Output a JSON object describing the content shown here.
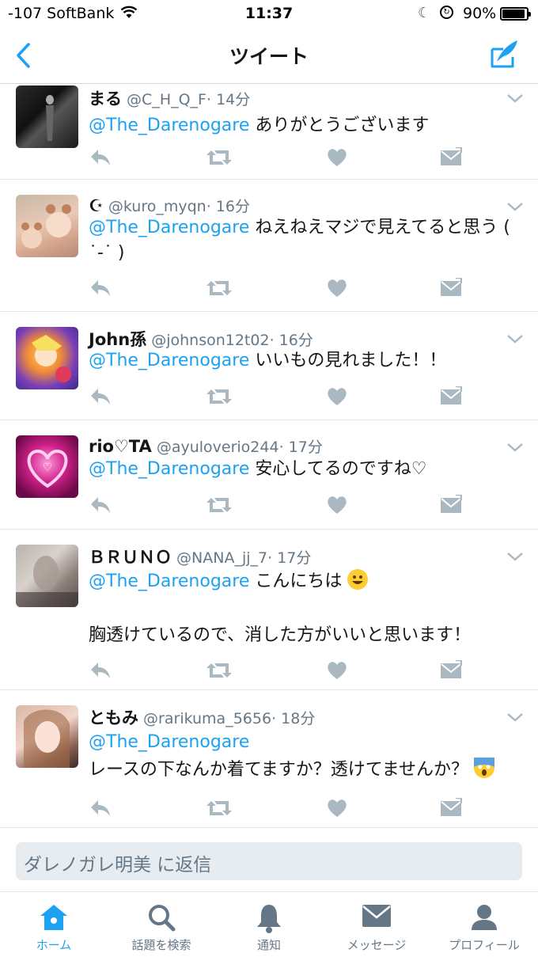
{
  "status_bar": {
    "carrier": "-107 SoftBank",
    "time": "11:37",
    "battery": "90%"
  },
  "nav": {
    "title": "ツイート"
  },
  "tweets": [
    {
      "name": "まる",
      "handle": "@C_H_Q_F",
      "time": "· 14分",
      "mention": "@The_Darenogare",
      "text": " ありがとうございます",
      "text2": ""
    },
    {
      "name": "☪",
      "handle": "@kuro_myqn",
      "time": "· 16分",
      "mention": "@The_Darenogare",
      "text": " ねえねえマジで見えてると思う ( ˙-˙ )",
      "text2": ""
    },
    {
      "name": "John孫",
      "handle": "@johnson12t02",
      "time": "· 16分",
      "mention": "@The_Darenogare",
      "text": " いいもの見れました！！",
      "text2": ""
    },
    {
      "name": "rio♡TA",
      "handle": "@ayuloverio244",
      "time": "· 17分",
      "mention": "@The_Darenogare",
      "text": " 安心してるのですね♡",
      "text2": ""
    },
    {
      "name": "ＢＲＵＮＯ",
      "handle": "@NANA_jj_7",
      "time": "· 17分",
      "mention": "@The_Darenogare",
      "text": " こんにちは",
      "text2": "胸透けているので、消した方がいいと思います！"
    },
    {
      "name": "ともみ",
      "handle": "@rarikuma_5656",
      "time": "· 18分",
      "mention": "@The_Darenogare",
      "text": "",
      "text2": "レースの下なんか着てますか？透けてませんか？"
    }
  ],
  "reply": {
    "placeholder": "ダレノガレ明美 に返信"
  },
  "tabs": [
    {
      "label": "ホーム",
      "icon": "home-icon",
      "active": true
    },
    {
      "label": "話題を検索",
      "icon": "search-icon",
      "active": false
    },
    {
      "label": "通知",
      "icon": "bell-icon",
      "active": false
    },
    {
      "label": "メッセージ",
      "icon": "envelope-icon",
      "active": false
    },
    {
      "label": "プロフィール",
      "icon": "person-icon",
      "active": false
    }
  ],
  "colors": {
    "accent": "#1da1f2",
    "icon_gray": "#aab8c2",
    "text_gray": "#657786"
  }
}
